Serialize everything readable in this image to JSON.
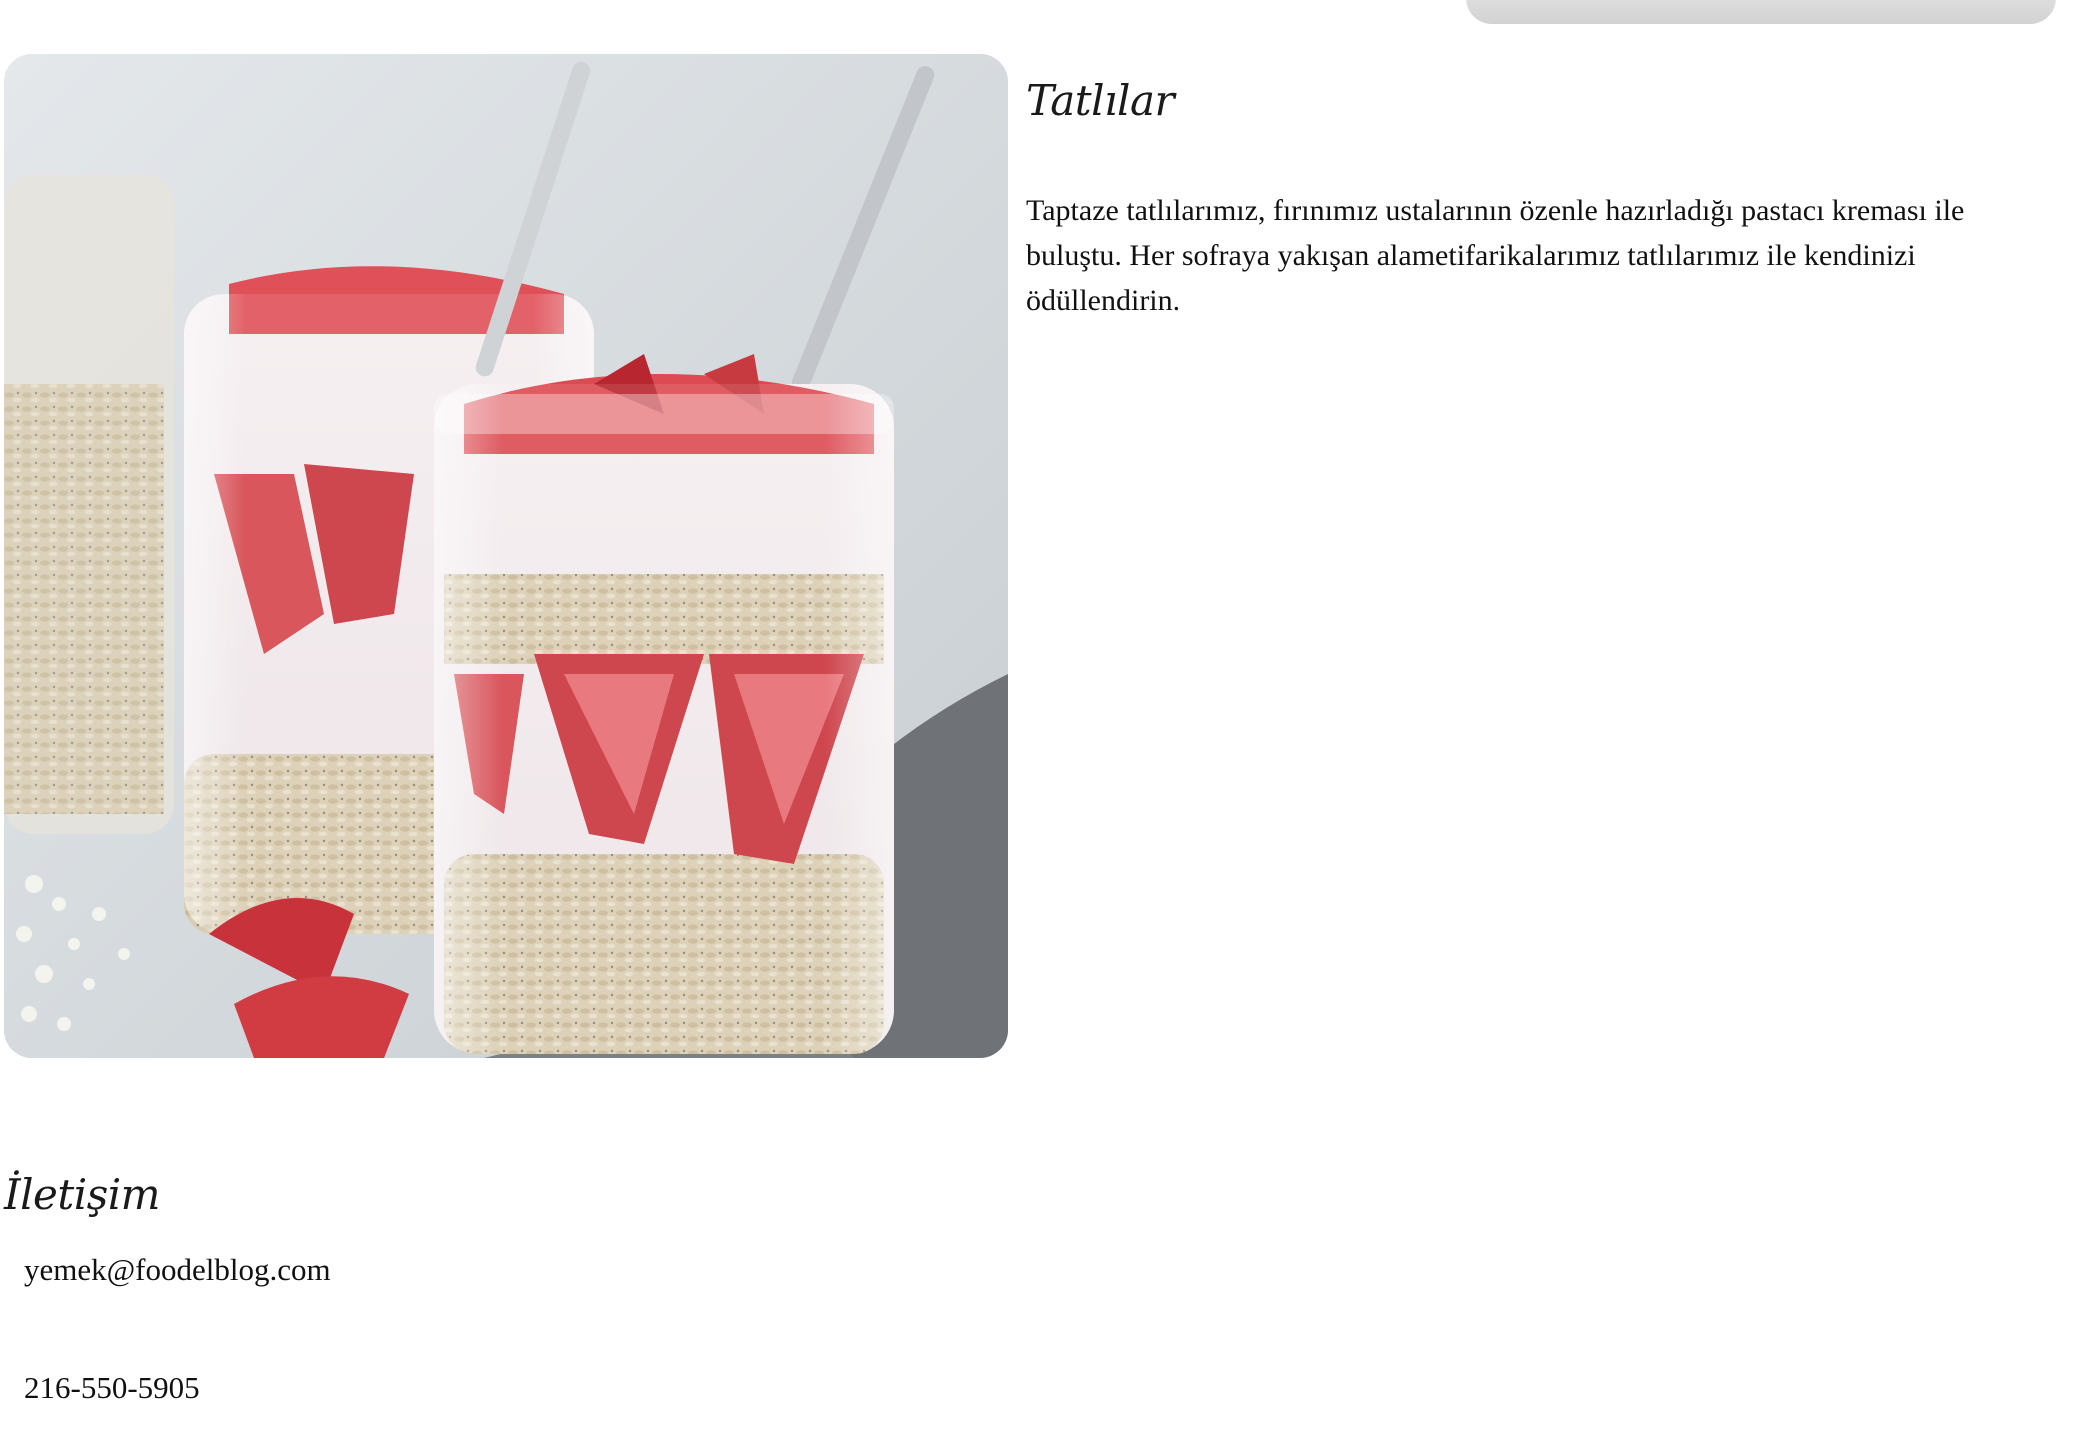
{
  "dessert_section": {
    "title": "Tatlılar",
    "description": "Taptaze tatlılarımız, fırınımız ustalarının özenle hazırladığı pastacı kreması ile buluştu. Her sofraya yakışan alametifarikalarımız tatlılarımız ile kendinizi ödüllendirin."
  },
  "contact_section": {
    "title": "İletişim",
    "email": "yemek@foodelblog.com",
    "phone": "216-550-5905"
  },
  "colors": {
    "text": "#111111",
    "background": "#ffffff",
    "strawberry": "#c8323a",
    "cream": "#f1e8ea",
    "oats": "#d8cbb0"
  }
}
